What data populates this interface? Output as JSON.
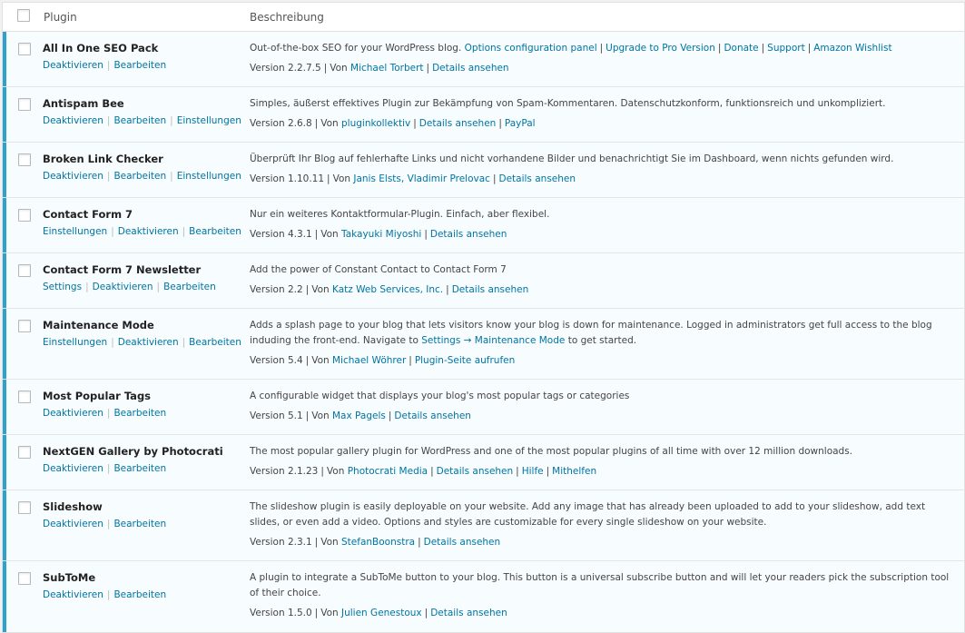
{
  "header": {
    "plugin_label": "Plugin",
    "description_label": "Beschreibung"
  },
  "plugins": [
    {
      "name": "All In One SEO Pack",
      "actions": [
        "Deaktivieren",
        "Bearbeiten"
      ],
      "desc_text": "Out-of-the-box SEO for your WordPress blog.",
      "desc_links": [
        "Options configuration panel",
        "Upgrade to Pro Version",
        "Donate",
        "Support",
        "Amazon Wishlist"
      ],
      "version": "Version 2.2.7.5",
      "by": "Von",
      "author": "Michael Torbert",
      "meta_links": [
        "Details ansehen"
      ]
    },
    {
      "name": "Antispam Bee",
      "actions": [
        "Deaktivieren",
        "Bearbeiten",
        "Einstellungen"
      ],
      "desc_text": "Simples, äußerst effektives Plugin zur Bekämpfung von Spam-Kommentaren. Datenschutzkonform, funktionsreich und unkompliziert.",
      "desc_links": [],
      "version": "Version 2.6.8",
      "by": "Von",
      "author": "pluginkollektiv",
      "meta_links": [
        "Details ansehen",
        "PayPal"
      ]
    },
    {
      "name": "Broken Link Checker",
      "actions": [
        "Deaktivieren",
        "Bearbeiten",
        "Einstellungen"
      ],
      "desc_text": "Überprüft Ihr Blog auf fehlerhafte Links und nicht vorhandene Bilder und benachrichtigt Sie im Dashboard, wenn nichts gefunden wird.",
      "desc_links": [],
      "version": "Version 1.10.11",
      "by": "Von",
      "author": "Janis Elsts, Vladimir Prelovac",
      "meta_links": [
        "Details ansehen"
      ]
    },
    {
      "name": "Contact Form 7",
      "actions": [
        "Einstellungen",
        "Deaktivieren",
        "Bearbeiten"
      ],
      "desc_text": "Nur ein weiteres Kontaktformular-Plugin. Einfach, aber flexibel.",
      "desc_links": [],
      "version": "Version 4.3.1",
      "by": "Von",
      "author": "Takayuki Miyoshi",
      "meta_links": [
        "Details ansehen"
      ]
    },
    {
      "name": "Contact Form 7 Newsletter",
      "actions": [
        "Settings",
        "Deaktivieren",
        "Bearbeiten"
      ],
      "desc_text": "Add the power of Constant Contact to Contact Form 7",
      "desc_links": [],
      "version": "Version 2.2",
      "by": "Von",
      "author": "Katz Web Services, Inc.",
      "meta_links": [
        "Details ansehen"
      ]
    },
    {
      "name": "Maintenance Mode",
      "actions": [
        "Einstellungen",
        "Deaktivieren",
        "Bearbeiten"
      ],
      "desc_text": "Adds a splash page to your blog that lets visitors know your blog is down for maintenance. Logged in administrators get full access to the blog induding the front-end. Navigate to",
      "desc_link_inline": "Settings → Maintenance Mode",
      "desc_after": "to get started.",
      "desc_links": [],
      "version": "Version 5.4",
      "by": "Von",
      "author": "Michael Wöhrer",
      "meta_links": [
        "Plugin-Seite aufrufen"
      ]
    },
    {
      "name": "Most Popular Tags",
      "actions": [
        "Deaktivieren",
        "Bearbeiten"
      ],
      "desc_text": "A configurable widget that displays your blog's most popular tags or categories",
      "desc_links": [],
      "version": "Version 5.1",
      "by": "Von",
      "author": "Max Pagels",
      "meta_links": [
        "Details ansehen"
      ]
    },
    {
      "name": "NextGEN Gallery by Photocrati",
      "actions": [
        "Deaktivieren",
        "Bearbeiten"
      ],
      "desc_text": "The most popular gallery plugin for WordPress and one of the most popular plugins of all time with over 12 million downloads.",
      "desc_links": [],
      "version": "Version 2.1.23",
      "by": "Von",
      "author": "Photocrati Media",
      "meta_links": [
        "Details ansehen",
        "Hilfe",
        "Mithelfen"
      ]
    },
    {
      "name": "Slideshow",
      "actions": [
        "Deaktivieren",
        "Bearbeiten"
      ],
      "desc_text": "The slideshow plugin is easily deployable on your website. Add any image that has already been uploaded to add to your slideshow, add text slides, or even add a video. Options and styles are customizable for every single slideshow on your website.",
      "desc_links": [],
      "version": "Version 2.3.1",
      "by": "Von",
      "author": "StefanBoonstra",
      "meta_links": [
        "Details ansehen"
      ]
    },
    {
      "name": "SubToMe",
      "actions": [
        "Deaktivieren",
        "Bearbeiten"
      ],
      "desc_text": "A plugin to integrate a SubToMe button to your blog. This button is a universal subscribe button and will let your readers pick the subscription tool of their choice.",
      "desc_links": [],
      "version": "Version 1.5.0",
      "by": "Von",
      "author": "Julien Genestoux",
      "meta_links": [
        "Details ansehen"
      ]
    }
  ]
}
